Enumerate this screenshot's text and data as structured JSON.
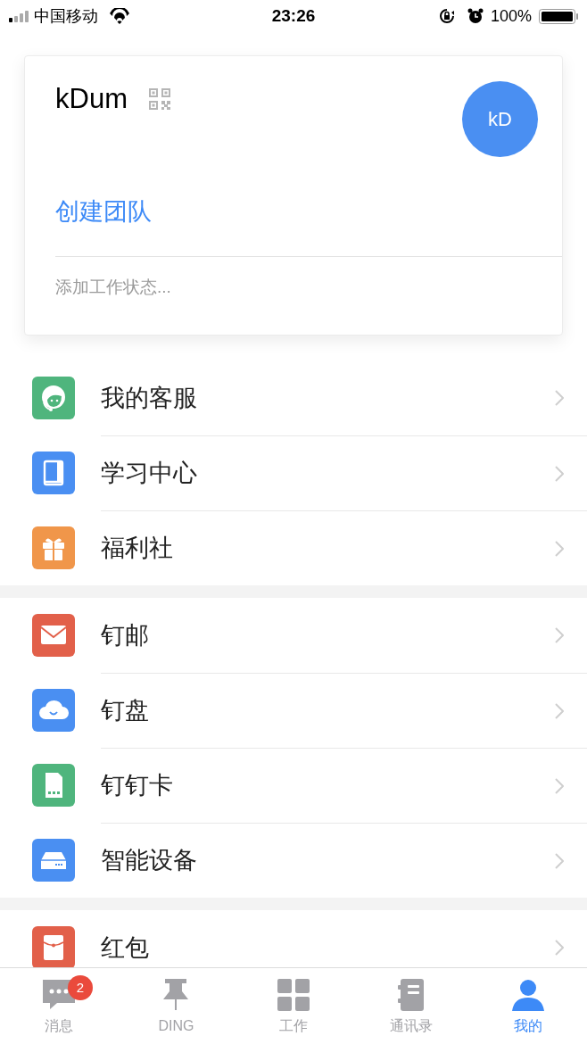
{
  "status_bar": {
    "carrier": "中国移动",
    "time": "23:26",
    "battery": "100%"
  },
  "profile": {
    "name": "kDum",
    "avatar": "kD",
    "action": "创建团队",
    "status_placeholder": "添加工作状态..."
  },
  "menu_groups": [
    [
      {
        "label": "我的客服",
        "kind": "service",
        "color": "#4fb57d"
      },
      {
        "label": "学习中心",
        "kind": "book",
        "color": "#4a8ff2"
      },
      {
        "label": "福利社",
        "kind": "gift",
        "color": "#f0964a"
      }
    ],
    [
      {
        "label": "钉邮",
        "kind": "mail",
        "color": "#e2604a"
      },
      {
        "label": "钉盘",
        "kind": "cloud",
        "color": "#4a8ff2"
      },
      {
        "label": "钉钉卡",
        "kind": "sim",
        "color": "#4fb57d"
      },
      {
        "label": "智能设备",
        "kind": "device",
        "color": "#4a8ff2"
      }
    ],
    [
      {
        "label": "红包",
        "kind": "packet",
        "color": "#e2604a"
      }
    ]
  ],
  "tabs": [
    {
      "label": "消息",
      "kind": "chat",
      "selected": false,
      "badge": "2"
    },
    {
      "label": "DING",
      "kind": "pin",
      "selected": false
    },
    {
      "label": "工作",
      "kind": "grid",
      "selected": false
    },
    {
      "label": "通讯录",
      "kind": "contacts",
      "selected": false
    },
    {
      "label": "我的",
      "kind": "person",
      "selected": true
    }
  ]
}
